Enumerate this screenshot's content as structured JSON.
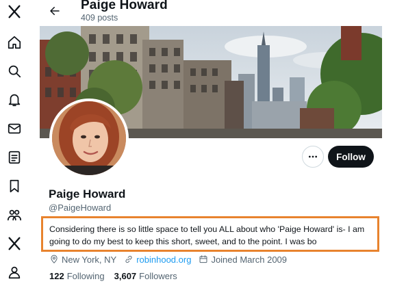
{
  "nav": {
    "items": [
      {
        "name": "x-logo-icon"
      },
      {
        "name": "home-icon"
      },
      {
        "name": "search-icon"
      },
      {
        "name": "notifications-icon"
      },
      {
        "name": "messages-icon"
      },
      {
        "name": "lists-icon"
      },
      {
        "name": "bookmarks-icon"
      },
      {
        "name": "communities-icon"
      },
      {
        "name": "premium-x-icon"
      },
      {
        "name": "profile-icon"
      }
    ]
  },
  "header": {
    "back_icon": "arrow-left-icon",
    "name": "Paige Howard",
    "posts": "409 posts"
  },
  "profile": {
    "name": "Paige Howard",
    "handle": "@PaigeHoward",
    "bio": "Considering there is so little space to tell you ALL about who 'Paige Howard' is- I am going to do my best to keep this short, sweet, and to the point. I was bo",
    "location": "New York, NY",
    "website": "robinhood.org",
    "joined": "Joined March 2009",
    "following_count": "122",
    "following_label": "Following",
    "followers_count": "3,607",
    "followers_label": "Followers"
  },
  "actions": {
    "more_icon": "ellipsis-icon",
    "follow_label": "Follow"
  },
  "colors": {
    "highlight_border": "#e8832e",
    "link": "#1d9bf0",
    "follow_bg": "#0f1419",
    "secondary_text": "#536471"
  }
}
